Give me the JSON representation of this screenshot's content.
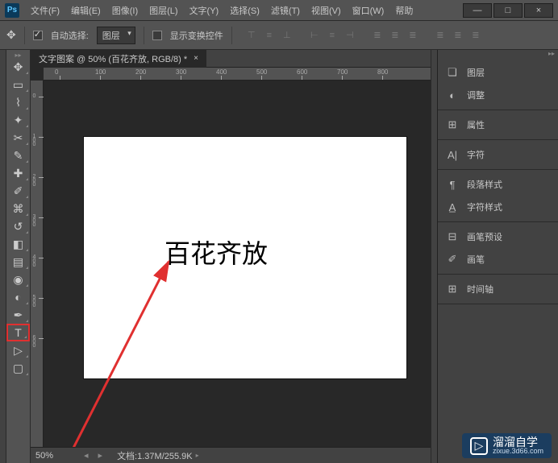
{
  "app": {
    "logo": "Ps"
  },
  "menu": {
    "file": "文件(F)",
    "edit": "编辑(E)",
    "image": "图像(I)",
    "layer": "图层(L)",
    "type": "文字(Y)",
    "select": "选择(S)",
    "filter": "滤镜(T)",
    "view": "视图(V)",
    "window": "窗口(W)",
    "help": "帮助"
  },
  "window_controls": {
    "min": "—",
    "max": "□",
    "close": "×"
  },
  "options": {
    "auto_select": "自动选择:",
    "target": "图层",
    "show_transform": "显示变换控件"
  },
  "document": {
    "tab": "文字图案 @ 50% (百花齐放, RGB/8) *",
    "canvas_text": "百花齐放",
    "zoom": "50%",
    "info": "文档:1.37M/255.9K"
  },
  "ruler_h": [
    "0",
    "100",
    "200",
    "300",
    "400",
    "500",
    "600",
    "700",
    "800"
  ],
  "ruler_v": [
    "0",
    "100",
    "200",
    "300",
    "400",
    "500",
    "600"
  ],
  "panels": {
    "layers": "图层",
    "adjustments": "调整",
    "properties": "属性",
    "character": "字符",
    "para_styles": "段落样式",
    "char_styles": "字符样式",
    "brush_presets": "画笔预设",
    "brush": "画笔",
    "timeline": "时间轴"
  },
  "watermark": {
    "title": "溜溜自学",
    "sub": "zixue.3d66.com"
  }
}
